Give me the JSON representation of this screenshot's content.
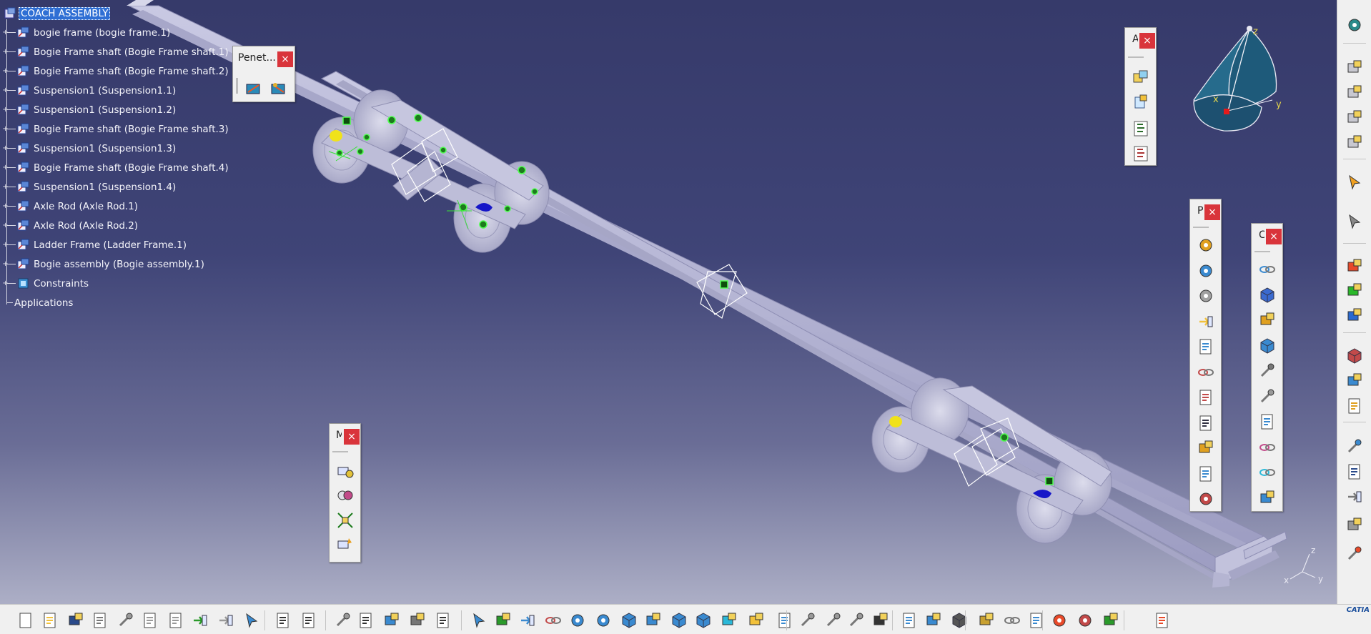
{
  "tree": {
    "root": "COACH ASSEMBLY",
    "items": [
      "bogie frame (bogie frame.1)",
      "Bogie Frame shaft (Bogie Frame shaft.1)",
      "Bogie Frame shaft (Bogie Frame shaft.2)",
      "Suspension1 (Suspension1.1)",
      "Suspension1 (Suspension1.2)",
      "Bogie Frame shaft (Bogie Frame shaft.3)",
      "Suspension1 (Suspension1.3)",
      "Bogie Frame shaft (Bogie Frame shaft.4)",
      "Suspension1 (Suspension1.4)",
      "Axle Rod (Axle Rod.1)",
      "Axle Rod (Axle Rod.2)",
      "Ladder Frame (Ladder Frame.1)",
      "Bogie assembly (Bogie assembly.1)"
    ],
    "constraints": "Constraints",
    "applications": "Applications"
  },
  "toolbars": {
    "penetration": {
      "title": "Penet...",
      "close": "×"
    },
    "a": {
      "title": "A",
      "close": "×"
    },
    "p": {
      "title": "P",
      "close": "×"
    },
    "c": {
      "title": "C",
      "close": "×"
    },
    "m": {
      "title": "M",
      "close": "×"
    }
  },
  "compass": {
    "x": "x",
    "y": "y",
    "z": "z"
  },
  "axis_triad": {
    "x": "x",
    "y": "y",
    "z": "z"
  },
  "bottom_toolbar": {
    "icons": [
      "new-icon",
      "open-icon",
      "save-icon",
      "print-icon",
      "cut-icon",
      "copy-icon",
      "paste-icon",
      "undo-icon",
      "redo-icon",
      "whats-this-icon",
      "formula-icon",
      "knowledge-icon",
      "lock-icon",
      "table-icon",
      "tree-expand-icon",
      "cache-icon",
      "macro-icon",
      "fly-mode-icon",
      "fit-all-icon",
      "pan-icon",
      "rotate-icon",
      "zoom-in-icon",
      "zoom-out-icon",
      "normal-view-icon",
      "multi-view-icon",
      "iso-view-icon",
      "shading-icon",
      "hide-show-icon",
      "swap-visible-icon",
      "graphic-properties-icon",
      "measure-icon",
      "measure-item-icon",
      "measure-inertia-icon",
      "capture-icon",
      "catalog-icon",
      "clash-icon",
      "section-icon",
      "distance-icon",
      "refresh-icon",
      "publish-icon",
      "material-icon",
      "render-icon",
      "apply-material-icon",
      "grid-icon"
    ]
  },
  "brand": "CATIA"
}
